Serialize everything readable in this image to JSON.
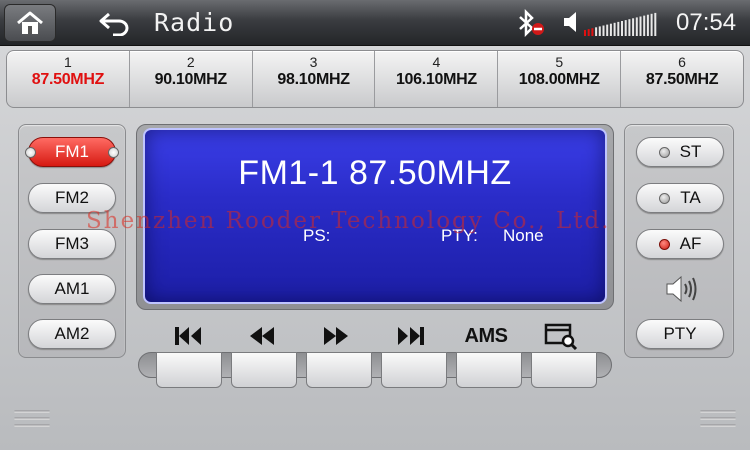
{
  "header": {
    "title": "Radio",
    "clock": "07:54",
    "volume_level": 0.15
  },
  "presets": [
    {
      "num": "1",
      "freq": "87.50MHZ",
      "active": true
    },
    {
      "num": "2",
      "freq": "90.10MHZ",
      "active": false
    },
    {
      "num": "3",
      "freq": "98.10MHZ",
      "active": false
    },
    {
      "num": "4",
      "freq": "106.10MHZ",
      "active": false
    },
    {
      "num": "5",
      "freq": "108.00MHZ",
      "active": false
    },
    {
      "num": "6",
      "freq": "87.50MHZ",
      "active": false
    }
  ],
  "bands": {
    "fm1": "FM1",
    "fm2": "FM2",
    "fm3": "FM3",
    "am1": "AM1",
    "am2": "AM2",
    "selected": "FM1"
  },
  "display": {
    "main": "FM1-1 87.50MHZ",
    "ps_label": "PS:",
    "pty_label": "PTY:",
    "pty_value": "None",
    "watermark": "Shenzhen Rooder Technology Co., Ltd."
  },
  "options": {
    "st": {
      "label": "ST",
      "on": false
    },
    "ta": {
      "label": "TA",
      "on": false
    },
    "af": {
      "label": "AF",
      "on": true
    },
    "pty": "PTY"
  },
  "transport": {
    "ams": "AMS"
  },
  "colors": {
    "accent_red": "#e01010",
    "display_blue": "#2a2cc8"
  }
}
